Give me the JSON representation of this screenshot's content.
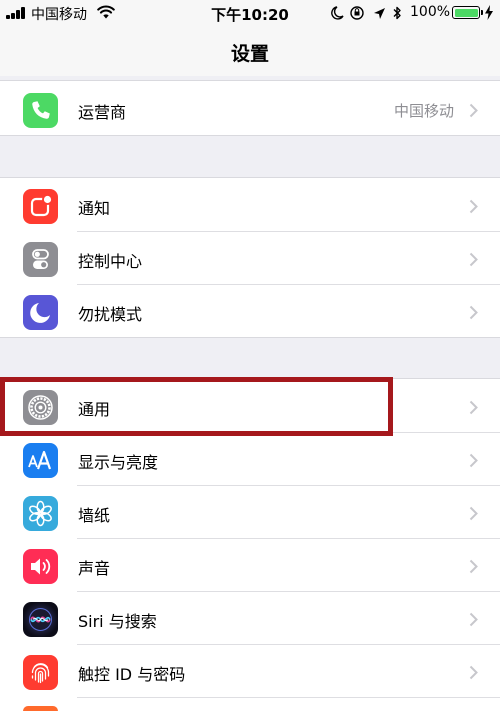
{
  "status_bar": {
    "carrier": "中国移动",
    "time": "下午10:20",
    "battery_percent": "100%",
    "battery_level": 1.0,
    "battery_color": "#4cd964"
  },
  "nav": {
    "title": "设置"
  },
  "groups": [
    {
      "rows": [
        {
          "label": "运营商",
          "value": "中国移动",
          "icon": "phone-icon",
          "color": "#4cd964"
        }
      ]
    },
    {
      "rows": [
        {
          "label": "通知",
          "icon": "notification-icon",
          "color": "#ff3b30"
        },
        {
          "label": "控制中心",
          "icon": "toggle-switch-icon",
          "color": "#8e8e93"
        },
        {
          "label": "勿扰模式",
          "icon": "moon-icon",
          "color": "#5856d6"
        }
      ]
    },
    {
      "rows": [
        {
          "label": "通用",
          "icon": "gear-icon",
          "color": "#8e8e93"
        },
        {
          "label": "显示与亮度",
          "icon": "text-size-icon",
          "color": "#1a7ef0"
        },
        {
          "label": "墙纸",
          "icon": "flower-icon",
          "color": "#36aadc"
        },
        {
          "label": "声音",
          "icon": "speaker-icon",
          "color": "#ff2d55"
        },
        {
          "label": "Siri 与搜索",
          "icon": "siri-icon",
          "color": "#1c1c2e"
        },
        {
          "label": "触控 ID 与密码",
          "icon": "fingerprint-icon",
          "color": "#ff3b30"
        }
      ]
    }
  ],
  "highlight_color": "#a5181c"
}
